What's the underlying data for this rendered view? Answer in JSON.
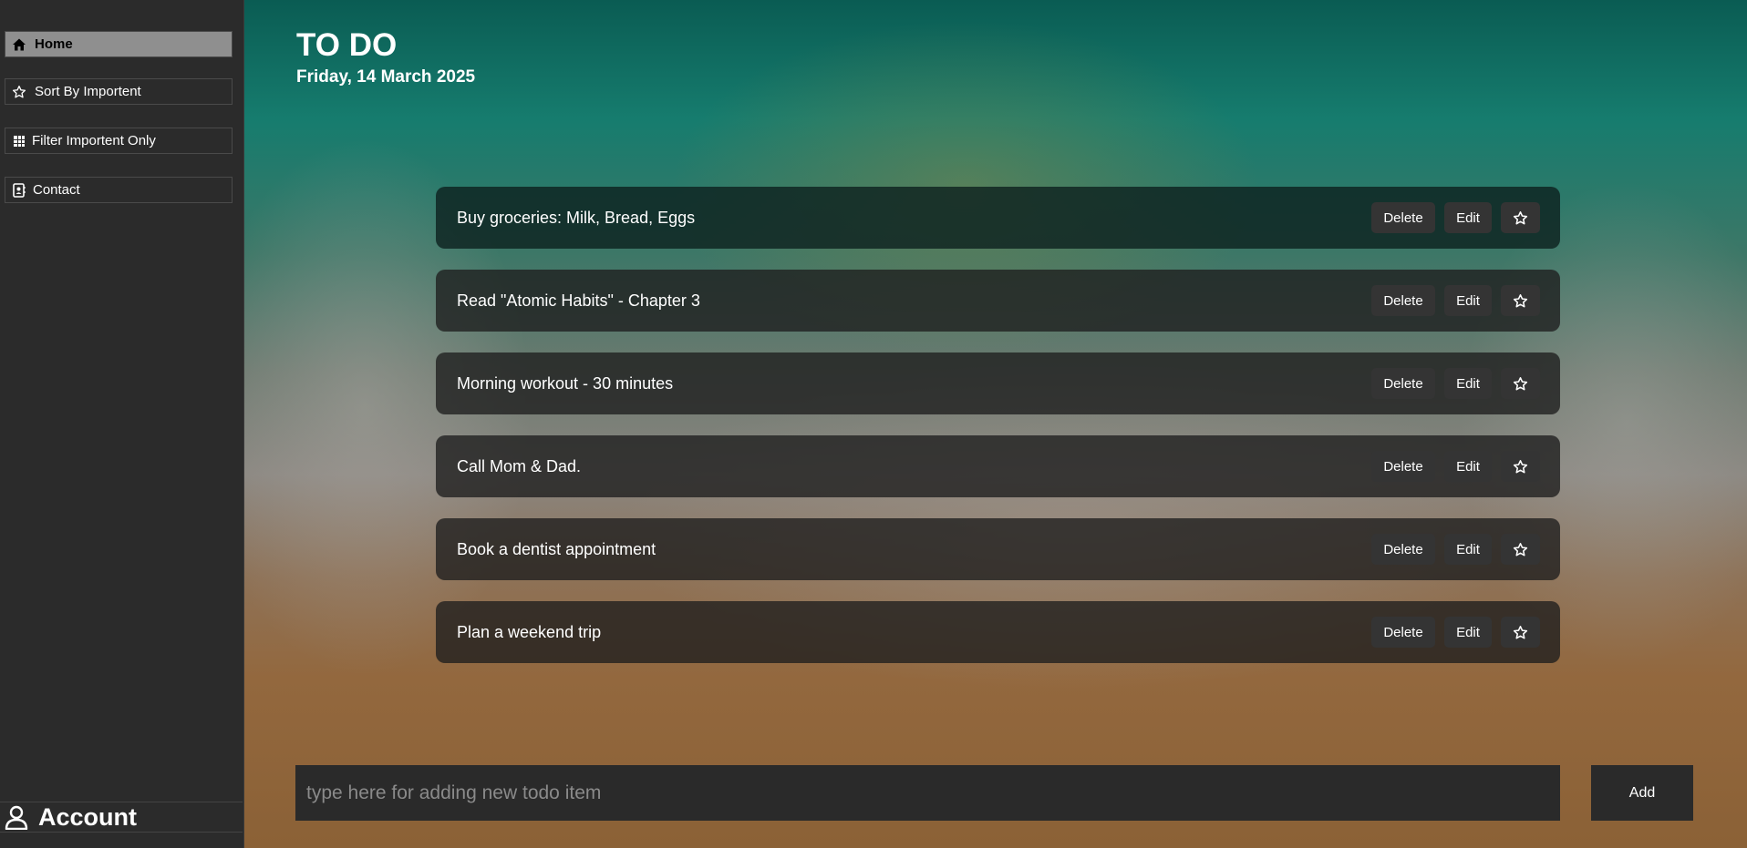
{
  "sidebar": {
    "items": [
      {
        "label": "Home",
        "icon": "home-icon",
        "active": true
      },
      {
        "label": "Sort By Importent",
        "icon": "star-icon"
      },
      {
        "label": "Filter Importent Only",
        "icon": "filter-grid-icon"
      },
      {
        "label": "Contact",
        "icon": "contact-card-icon"
      }
    ],
    "account_label": "Account",
    "account_icon": "user-icon"
  },
  "header": {
    "title": "TO DO",
    "date": "Friday, 14 March 2025"
  },
  "todos": [
    {
      "text": "Buy groceries: Milk, Bread, Eggs",
      "delete_label": "Delete",
      "edit_label": "Edit"
    },
    {
      "text": "Read \"Atomic Habits\" - Chapter 3",
      "delete_label": "Delete",
      "edit_label": "Edit"
    },
    {
      "text": "Morning workout - 30 minutes",
      "delete_label": "Delete",
      "edit_label": "Edit"
    },
    {
      "text": "Call Mom & Dad.",
      "delete_label": "Delete",
      "edit_label": "Edit"
    },
    {
      "text": "Book a dentist appointment",
      "delete_label": "Delete",
      "edit_label": "Edit"
    },
    {
      "text": "Plan a weekend trip",
      "delete_label": "Delete",
      "edit_label": "Edit"
    }
  ],
  "add_bar": {
    "placeholder": "type here for adding new todo item",
    "value": "",
    "button_label": "Add"
  },
  "colors": {
    "sidebar_bg": "#2b2b2b",
    "active_item_bg": "#8f8f8f",
    "row_bg": "#1e1e1e",
    "button_bg": "#343434"
  }
}
